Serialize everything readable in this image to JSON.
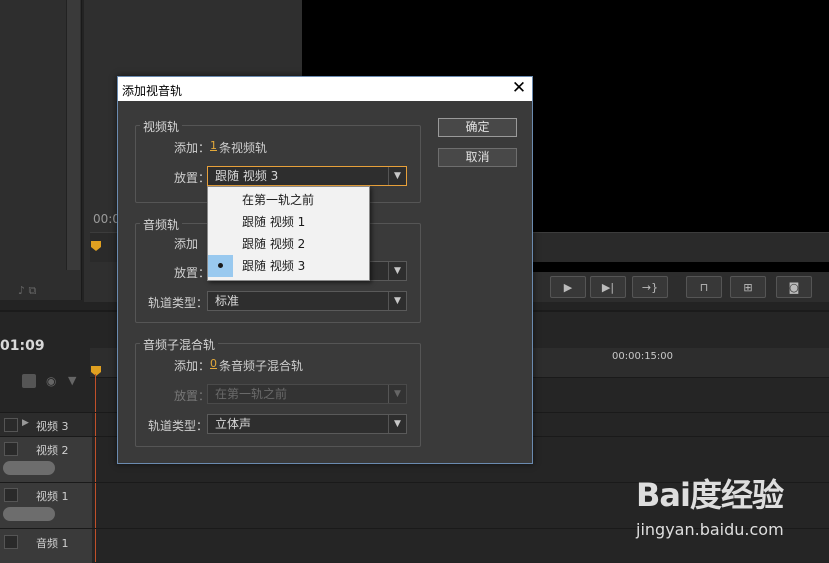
{
  "dialog": {
    "title": "添加视音轨",
    "ok_label": "确定",
    "cancel_label": "取消",
    "video": {
      "group_label": "视频轨",
      "add_label": "添加：",
      "count": "1",
      "count_suffix": "条视频轨",
      "placement_label": "放置：",
      "placement_value": "跟随 视频 3"
    },
    "audio": {
      "group_label": "音频轨",
      "add_label": "添加",
      "placement_label": "放置：",
      "track_type_label": "轨道类型：",
      "track_type_value": "标准"
    },
    "submix": {
      "group_label": "音频子混合轨",
      "add_label": "添加：",
      "count": "0",
      "count_suffix": "条音频子混合轨",
      "placement_label": "放置：",
      "placement_value": "在第一轨之前",
      "track_type_label": "轨道类型：",
      "track_type_value": "立体声"
    },
    "dropdown_options": [
      "在第一轨之前",
      "跟随 视频 1",
      "跟随 视频 2",
      "跟随 视频 3"
    ],
    "dropdown_selected_index": 3
  },
  "background": {
    "timecode_main": "01:09",
    "timecode_small": "00:0",
    "ruler_label": "00:00:15:00",
    "tracks": [
      {
        "name": "视频 3"
      },
      {
        "name": "视频 2"
      },
      {
        "name": "视频 1"
      },
      {
        "name": "音频 1"
      }
    ]
  },
  "watermark": {
    "main": "Bai度经验",
    "sub": "jingyan.baidu.com"
  },
  "colors": {
    "accent": "#e7a03a",
    "highlight": "#99c9ef",
    "dialog_bg": "#3a3a3a",
    "playhead": "#c0502a"
  }
}
